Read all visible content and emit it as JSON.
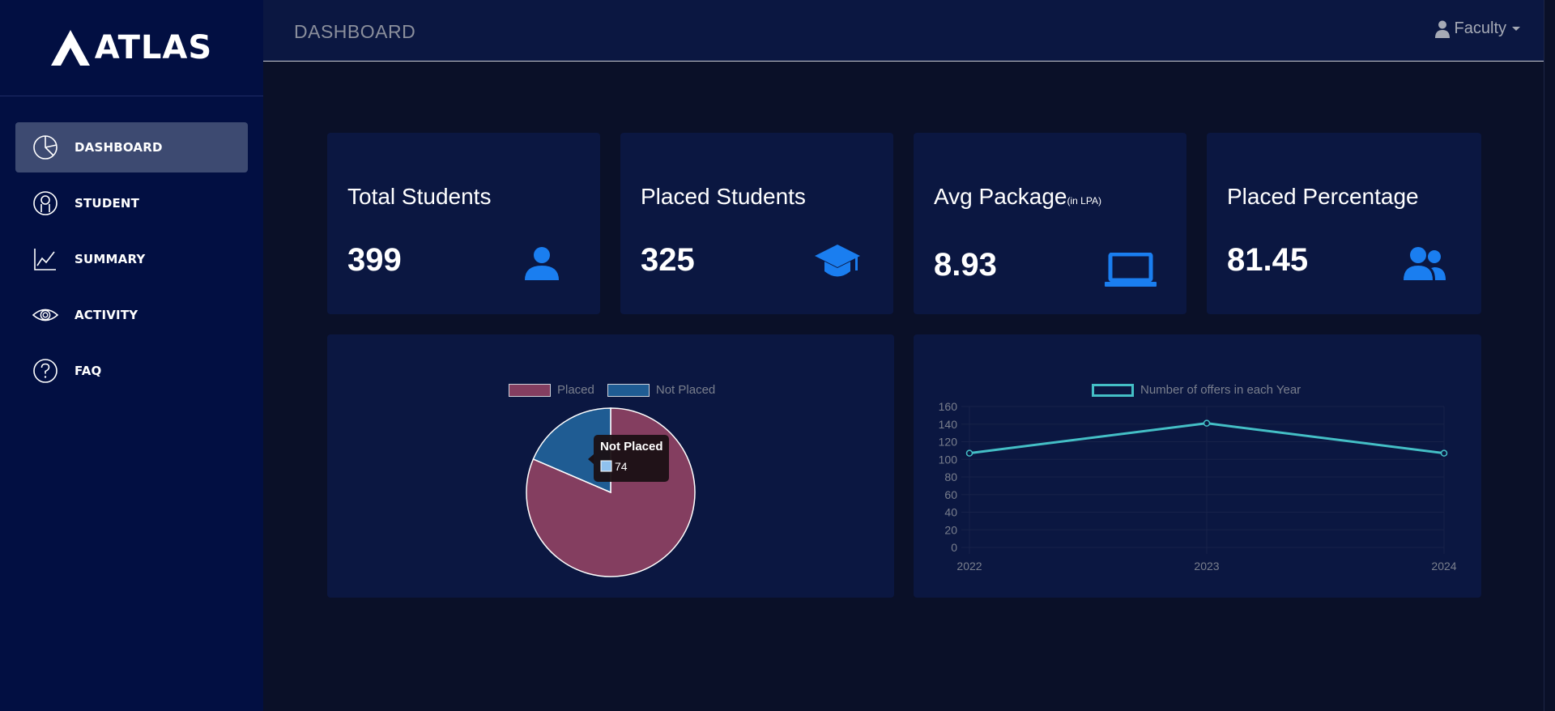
{
  "brand": {
    "name": "ATLAS"
  },
  "header": {
    "title": "DASHBOARD",
    "user_label": "Faculty"
  },
  "sidebar": {
    "items": [
      {
        "label": "DASHBOARD",
        "icon": "pie-chart-icon",
        "active": true
      },
      {
        "label": "STUDENT",
        "icon": "user-circle-icon",
        "active": false
      },
      {
        "label": "SUMMARY",
        "icon": "line-chart-icon",
        "active": false
      },
      {
        "label": "ACTIVITY",
        "icon": "eye-icon",
        "active": false
      },
      {
        "label": "FAQ",
        "icon": "question-icon",
        "active": false
      }
    ]
  },
  "stats": [
    {
      "title": "Total Students",
      "value": "399",
      "icon": "person-icon"
    },
    {
      "title": "Placed Students",
      "value": "325",
      "icon": "graduation-cap-icon"
    },
    {
      "title": "Avg Package",
      "suffix": "(in LPA)",
      "value": "8.93",
      "icon": "laptop-icon"
    },
    {
      "title": "Placed Percentage",
      "value": "81.45",
      "icon": "users-icon"
    }
  ],
  "colors": {
    "accent_blue": "#1a7ef0",
    "placed": "#843e60",
    "not_placed": "#1f5c93",
    "line": "#44bfc6"
  },
  "chart_data": [
    {
      "type": "pie",
      "labels": [
        "Placed",
        "Not Placed"
      ],
      "values": [
        325,
        74
      ],
      "legend": "top",
      "tooltip": {
        "title": "Not Placed",
        "value": "74"
      }
    },
    {
      "type": "line",
      "x": [
        "2022",
        "2023",
        "2024"
      ],
      "series": [
        {
          "name": "Number of offers in each Year",
          "values": [
            107,
            141,
            107
          ]
        }
      ],
      "ylim": [
        0,
        160
      ],
      "yticks": [
        "160",
        "140",
        "120",
        "100",
        "80",
        "60",
        "40",
        "20",
        "0"
      ],
      "legend": "top",
      "grid": true
    }
  ]
}
